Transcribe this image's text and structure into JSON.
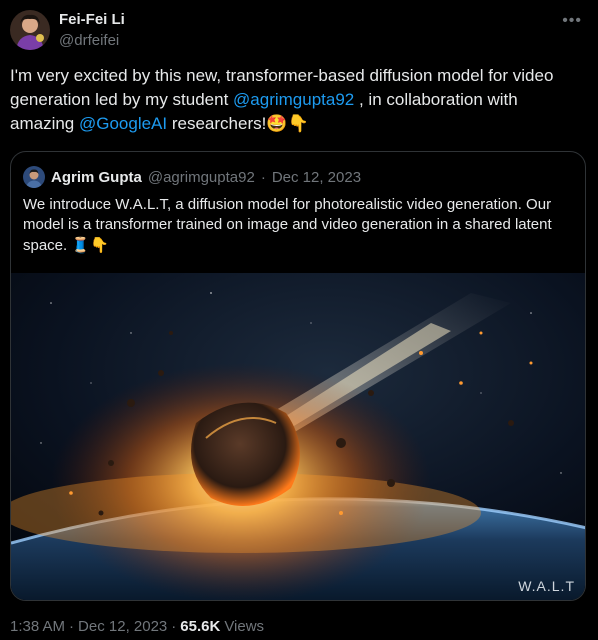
{
  "author": {
    "name": "Fei-Fei Li",
    "handle": "@drfeifei",
    "more_icon": "more-horizontal-icon"
  },
  "tweet": {
    "text_part1": "I'm very excited by this new, transformer-based diffusion model for video generation led by my student ",
    "mention1": "@agrimgupta92",
    "text_part2": " , in collaboration with amazing ",
    "mention2": "@GoogleAI",
    "text_part3": " researchers!",
    "emoji": "🤩👇"
  },
  "quoted_tweet": {
    "author_name": "Agrim Gupta",
    "author_handle": "@agrimgupta92",
    "separator": "·",
    "date": "Dec 12, 2023",
    "text": "We introduce W.A.L.T, a diffusion model for photorealistic video generation. Our model is a transformer trained on image and video generation in a shared latent space.",
    "emoji": "🧵👇",
    "media_watermark": "W.A.L.T"
  },
  "footer": {
    "time": "1:38 AM",
    "sep1": "·",
    "date": "Dec 12, 2023",
    "sep2": "·",
    "views_count": "65.6K",
    "views_label": "Views"
  },
  "colors": {
    "background": "#000000",
    "text": "#e7e9ea",
    "muted": "#71767b",
    "link": "#1d9bf0",
    "border": "#2f3336"
  }
}
